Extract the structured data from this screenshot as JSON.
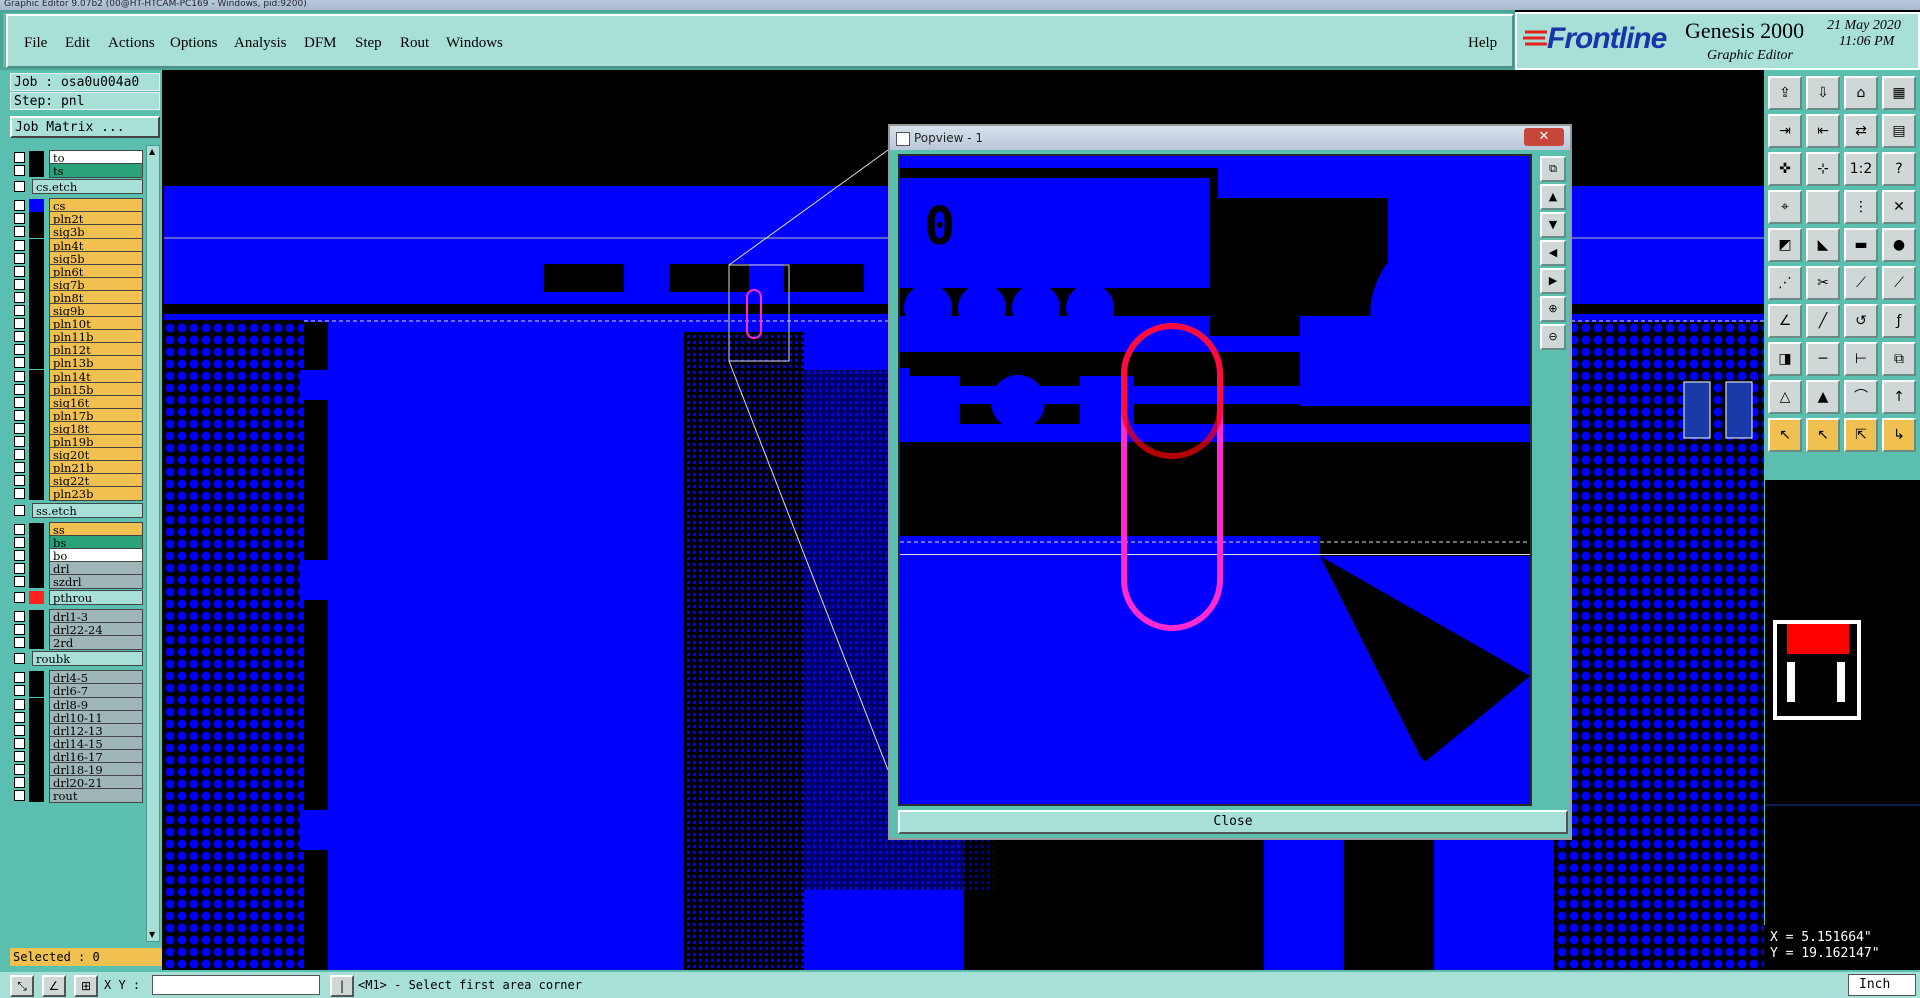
{
  "window": {
    "title": "Graphic Editor 9.07b2 (00@HT-HTCAM-PC169 - Windows, pid:9200)"
  },
  "menu": {
    "items": [
      "File",
      "Edit",
      "Actions",
      "Options",
      "Analysis",
      "DFM",
      "Step",
      "Rout",
      "Windows"
    ],
    "help": "Help"
  },
  "brand": {
    "logo": "Frontline",
    "product": "Genesis 2000",
    "subtitle": "Graphic Editor",
    "date": "21 May 2020",
    "time": "11:06 PM"
  },
  "job": {
    "job": "Job : osa0u004a0",
    "step": "Step: pnl",
    "matrix_button": "Job Matrix ..."
  },
  "layers": [
    {
      "name": "to",
      "color": "#ffffff",
      "swatch": "#000000"
    },
    {
      "name": "ts",
      "color": "#2aa37a",
      "swatch": "#000000"
    },
    {
      "name": "cs.etch",
      "color": "#a8e0d8",
      "swatch": "#5bbfb0",
      "section": true
    },
    {
      "name": "cs",
      "color": "#f0c050",
      "swatch": "#0000ff"
    },
    {
      "name": "pln2t",
      "color": "#f0c050",
      "swatch": "#000000"
    },
    {
      "name": "sig3b",
      "color": "#f0c050",
      "swatch": "#000000"
    },
    {
      "name": "pln4t",
      "color": "#f0c050",
      "swatch": "#000000"
    },
    {
      "name": "sig5b",
      "color": "#f0c050",
      "swatch": "#000000"
    },
    {
      "name": "pln6t",
      "color": "#f0c050",
      "swatch": "#000000"
    },
    {
      "name": "sig7b",
      "color": "#f0c050",
      "swatch": "#000000"
    },
    {
      "name": "pln8t",
      "color": "#f0c050",
      "swatch": "#000000"
    },
    {
      "name": "sig9b",
      "color": "#f0c050",
      "swatch": "#000000"
    },
    {
      "name": "pln10t",
      "color": "#f0c050",
      "swatch": "#000000"
    },
    {
      "name": "pln11b",
      "color": "#f0c050",
      "swatch": "#000000"
    },
    {
      "name": "pln12t",
      "color": "#f0c050",
      "swatch": "#000000"
    },
    {
      "name": "pln13b",
      "color": "#f0c050",
      "swatch": "#000000"
    },
    {
      "name": "pln14t",
      "color": "#f0c050",
      "swatch": "#000000"
    },
    {
      "name": "pln15b",
      "color": "#f0c050",
      "swatch": "#000000"
    },
    {
      "name": "sig16t",
      "color": "#f0c050",
      "swatch": "#000000"
    },
    {
      "name": "pln17b",
      "color": "#f0c050",
      "swatch": "#000000"
    },
    {
      "name": "sig18t",
      "color": "#f0c050",
      "swatch": "#000000"
    },
    {
      "name": "pln19b",
      "color": "#f0c050",
      "swatch": "#000000"
    },
    {
      "name": "sig20t",
      "color": "#f0c050",
      "swatch": "#000000"
    },
    {
      "name": "pln21b",
      "color": "#f0c050",
      "swatch": "#000000"
    },
    {
      "name": "sig22t",
      "color": "#f0c050",
      "swatch": "#000000"
    },
    {
      "name": "pln23b",
      "color": "#f0c050",
      "swatch": "#000000"
    },
    {
      "name": "ss.etch",
      "color": "#a8e0d8",
      "swatch": "#5bbfb0",
      "section": true
    },
    {
      "name": "ss",
      "color": "#f0c050",
      "swatch": "#000000"
    },
    {
      "name": "bs",
      "color": "#2aa37a",
      "swatch": "#000000"
    },
    {
      "name": "bo",
      "color": "#ffffff",
      "swatch": "#000000"
    },
    {
      "name": "drl",
      "color": "#9fb6b8",
      "swatch": "#000000"
    },
    {
      "name": "szdrl",
      "color": "#9fb6b8",
      "swatch": "#000000"
    },
    {
      "name": "pthrou",
      "color": "#a8e0d8",
      "swatch": "#ff2020",
      "section": true
    },
    {
      "name": "drl1-3",
      "color": "#9fb6b8",
      "swatch": "#000000"
    },
    {
      "name": "drl22-24",
      "color": "#9fb6b8",
      "swatch": "#000000"
    },
    {
      "name": "2rd",
      "color": "#9fb6b8",
      "swatch": "#000000"
    },
    {
      "name": "roubk",
      "color": "#a8e0d8",
      "swatch": "#5bbfb0",
      "section": true
    },
    {
      "name": "drl4-5",
      "color": "#9fb6b8",
      "swatch": "#000000"
    },
    {
      "name": "drl6-7",
      "color": "#9fb6b8",
      "swatch": "#000000"
    },
    {
      "name": "drl8-9",
      "color": "#9fb6b8",
      "swatch": "#000000"
    },
    {
      "name": "drl10-11",
      "color": "#9fb6b8",
      "swatch": "#000000"
    },
    {
      "name": "drl12-13",
      "color": "#9fb6b8",
      "swatch": "#000000"
    },
    {
      "name": "drl14-15",
      "color": "#9fb6b8",
      "swatch": "#000000"
    },
    {
      "name": "drl16-17",
      "color": "#9fb6b8",
      "swatch": "#000000"
    },
    {
      "name": "drl18-19",
      "color": "#9fb6b8",
      "swatch": "#000000"
    },
    {
      "name": "drl20-21",
      "color": "#9fb6b8",
      "swatch": "#000000"
    },
    {
      "name": "rout",
      "color": "#9fb6b8",
      "swatch": "#000000"
    }
  ],
  "selected": "Selected : 0",
  "coords": {
    "x": "X = 5.151664\"",
    "y": "Y = 19.162147\""
  },
  "status": {
    "xy_label": "X Y :",
    "xy_value": "",
    "prompt": "<M1> - Select first area corner",
    "units": "Inch"
  },
  "popview": {
    "title": "Popview - 1",
    "close": "Close",
    "marker": "0"
  },
  "colors": {
    "board": "#0000ff",
    "frame": "#5bbfb0",
    "panel_light": "#a8e0d8",
    "highlight": "#ff2bd0"
  }
}
